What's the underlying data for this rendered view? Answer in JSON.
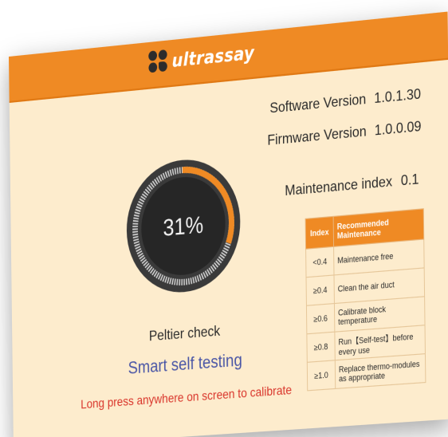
{
  "header": {
    "logo_text": "ultrassay"
  },
  "info": {
    "software_label": "Software Version",
    "software_value": "1.0.1.30",
    "firmware_label": "Firmware Version",
    "firmware_value": "1.0.0.09"
  },
  "gauge": {
    "percent_text": "31%",
    "progress": 0.31
  },
  "status": {
    "check_label": "Peltier check",
    "mode_label": "Smart self testing",
    "instruction": "Long press anywhere on screen to calibrate"
  },
  "maintenance": {
    "label": "Maintenance index",
    "value": "0.1",
    "table": {
      "headers": [
        "Index",
        "Recommended Maintenance"
      ],
      "rows": [
        [
          "<0.4",
          "Maintenance free"
        ],
        [
          "≥0.4",
          "Clean the air duct"
        ],
        [
          "≥0.6",
          "Calibrate block temperature"
        ],
        [
          "≥0.8",
          "Run【Self-test】before every use"
        ],
        [
          "≥1.0",
          "Replace thermo-modules as appropriate"
        ]
      ]
    }
  },
  "colors": {
    "brand_orange": "#ef8a24",
    "screen_bg": "#fdeccd",
    "gauge_progress": "#ef8a24",
    "gauge_track": "#cfcfcf",
    "mode_text": "#4a56a6",
    "instruction_text": "#d9352b"
  }
}
